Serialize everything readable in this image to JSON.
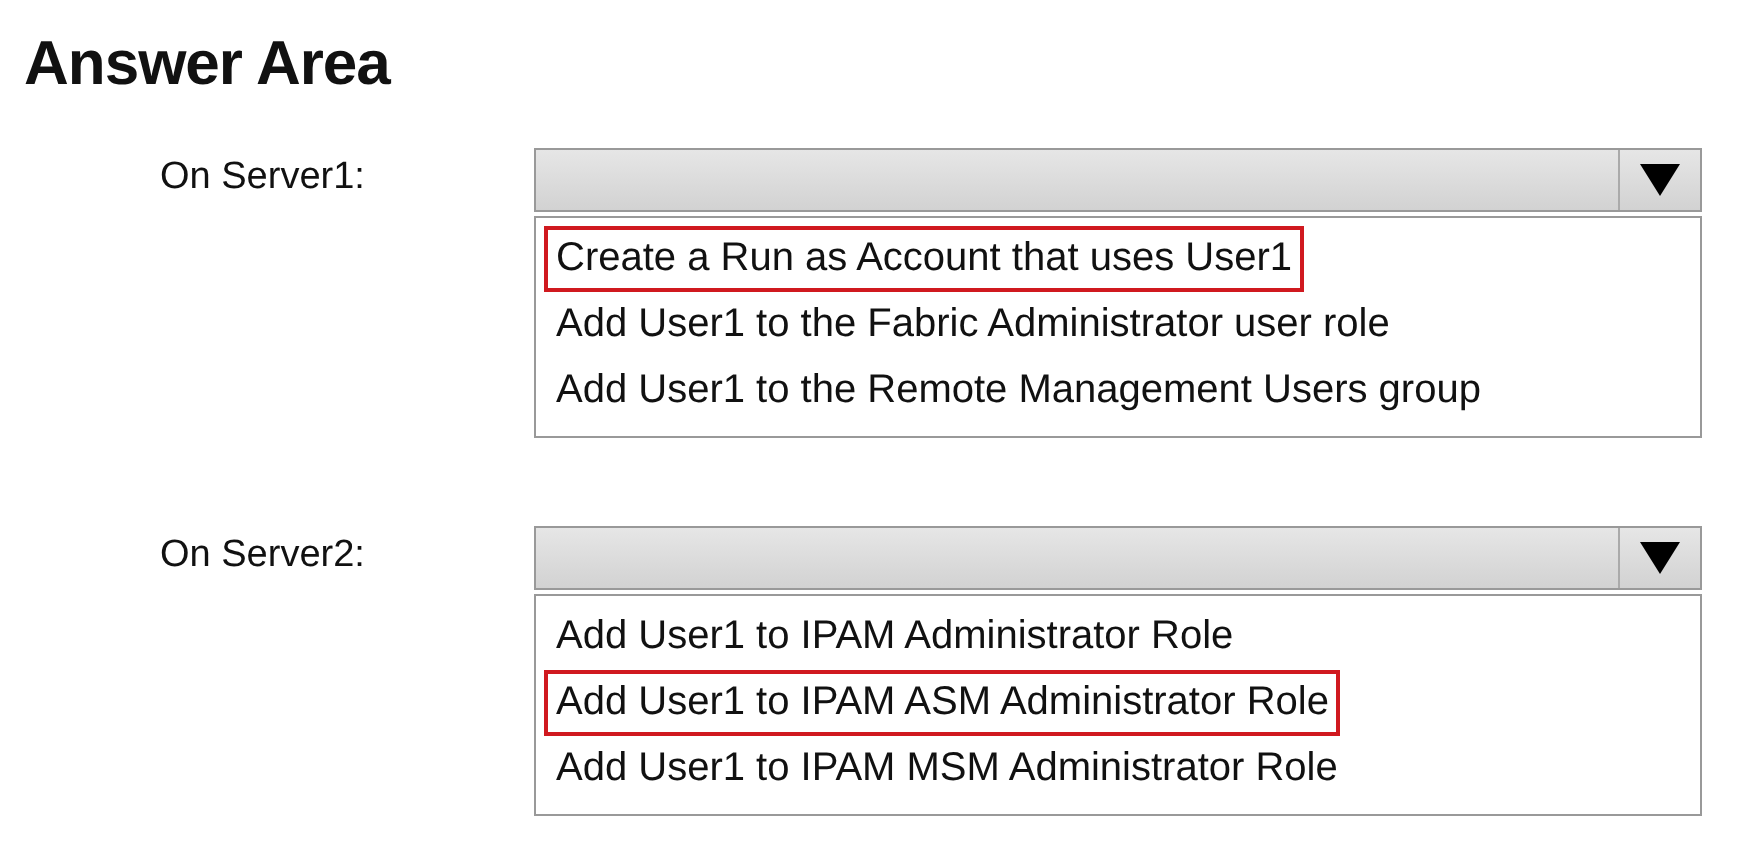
{
  "title": "Answer Area",
  "questions": [
    {
      "label": "On Server1:",
      "options": [
        {
          "text": "Create a Run as Account that uses User1",
          "selected": true
        },
        {
          "text": "Add User1 to the Fabric Administrator user role",
          "selected": false
        },
        {
          "text": "Add User1 to the Remote Management Users group",
          "selected": false
        }
      ]
    },
    {
      "label": "On Server2:",
      "options": [
        {
          "text": "Add User1 to IPAM Administrator Role",
          "selected": false
        },
        {
          "text": "Add User1 to IPAM ASM Administrator Role",
          "selected": true
        },
        {
          "text": "Add User1 to IPAM MSM Administrator Role",
          "selected": false
        }
      ]
    }
  ]
}
